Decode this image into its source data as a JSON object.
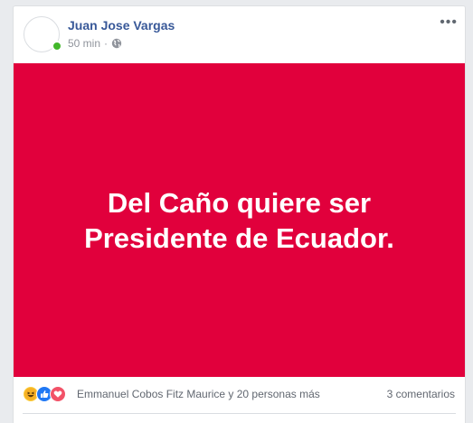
{
  "post": {
    "author": "Juan Jose Vargas",
    "time": "50 min",
    "separator": "·",
    "more_label": "•••",
    "text": "Del Caño quiere ser Presidente de Ecuador.",
    "background_color": "#e1003c",
    "privacy_icon": "globe-icon",
    "online_status_color": "#42b72a"
  },
  "reactions": {
    "types": [
      "haha",
      "like",
      "love"
    ],
    "summary": "Emmanuel Cobos Fitz Maurice y 20 personas más",
    "comments": "3 comentarios"
  }
}
